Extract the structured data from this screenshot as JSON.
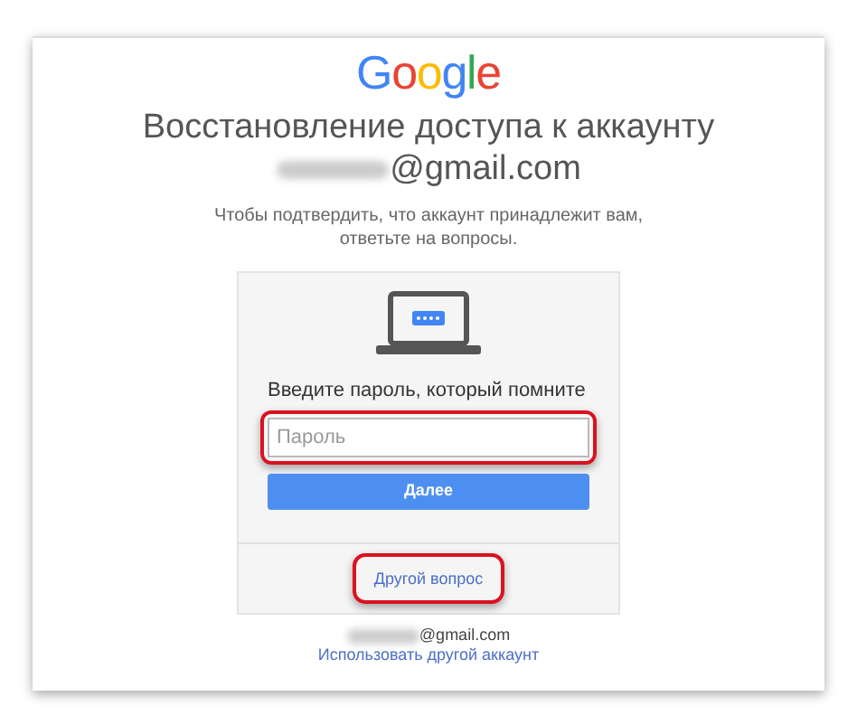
{
  "logo": "Google",
  "title": "Восстановление доступа к аккаунту",
  "account": {
    "email_suffix": "@gmail.com",
    "redacted": true
  },
  "instructions": "Чтобы подтвердить, что аккаунт принадлежит вам,\nответьте на вопросы.",
  "card": {
    "prompt": "Введите пароль, который помните",
    "password_field": {
      "placeholder": "Пароль",
      "highlighted": true
    },
    "next_button": "Далее",
    "other_question_link": {
      "label": "Другой вопрос",
      "highlighted": true
    }
  },
  "footer": {
    "email_suffix": "@gmail.com",
    "redacted": true,
    "switch_account_link": "Использовать другой аккаунт"
  }
}
